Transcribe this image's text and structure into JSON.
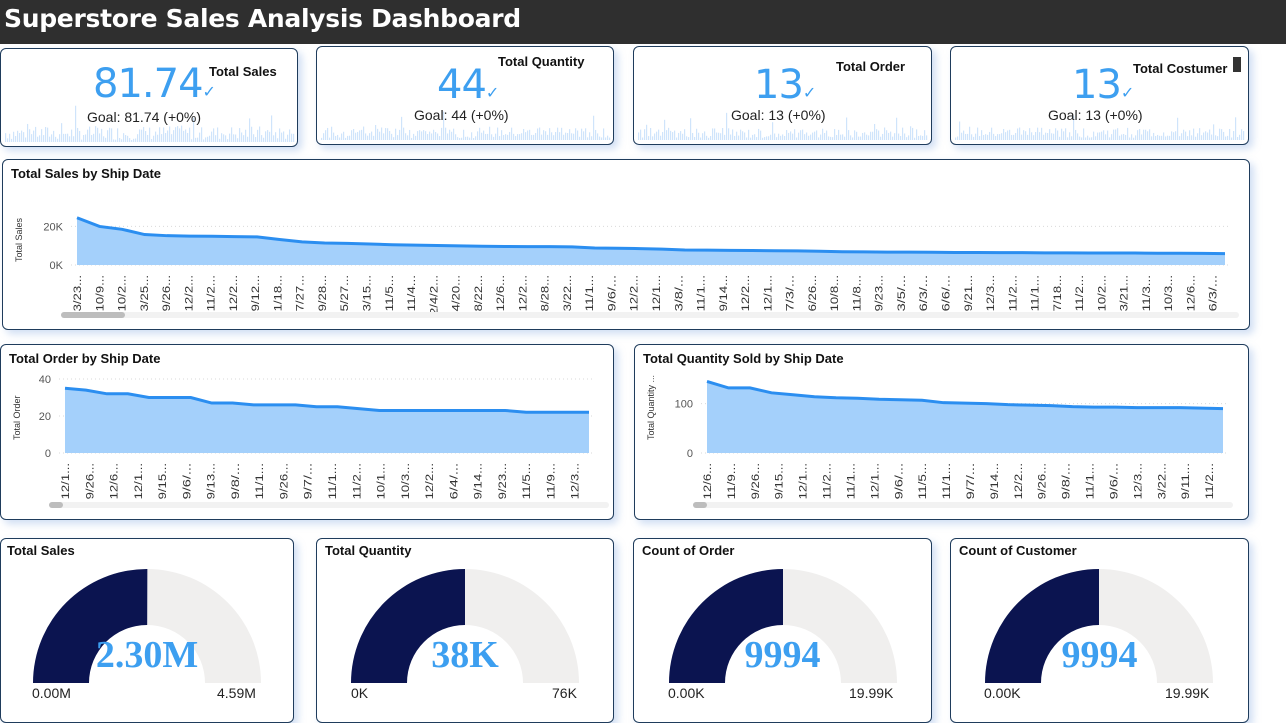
{
  "title": "Superstore Sales Analysis Dashboard",
  "kpis": [
    {
      "title": "Total Sales",
      "value": "81.74",
      "goal": "Goal: 81.74 (+0%)"
    },
    {
      "title": "Total Quantity",
      "value": "44",
      "goal": "Goal: 44 (+0%)"
    },
    {
      "title": "Total Order",
      "value": "13",
      "goal": "Goal: 13 (+0%)"
    },
    {
      "title": "Total Costumer",
      "value": "13",
      "goal": "Goal: 13 (+0%)"
    }
  ],
  "check_glyph": "✓",
  "charts": {
    "sales_by_ship_date": {
      "title": "Total Sales by Ship Date",
      "ylabel": "Total Sales",
      "yticks": [
        "20K",
        "0K"
      ]
    },
    "order_by_ship_date": {
      "title": "Total Order by Ship Date",
      "ylabel": "Total Order",
      "yticks": [
        "40",
        "20",
        "0"
      ]
    },
    "quantity_by_ship_date": {
      "title": "Total Quantity Sold by Ship Date",
      "ylabel": "Total Quantity ...",
      "yticks": [
        "100",
        "0"
      ]
    }
  },
  "chart_data": [
    {
      "type": "area",
      "title": "Total Sales by Ship Date",
      "ylabel": "Total Sales",
      "ylim": [
        0,
        28000
      ],
      "categories": [
        "3/23...",
        "10/9...",
        "10/2...",
        "3/25...",
        "9/26...",
        "12/2...",
        "11/2...",
        "12/2...",
        "9/12...",
        "1/18...",
        "7/27...",
        "9/28...",
        "5/27...",
        "3/15...",
        "11/5...",
        "11/4...",
        "2/4/2...",
        "4/20...",
        "8/22...",
        "12/6...",
        "12/2...",
        "8/28...",
        "3/22...",
        "11/1...",
        "9/6/...",
        "12/2...",
        "12/1...",
        "3/8/...",
        "11/1...",
        "9/14...",
        "12/2...",
        "12/1...",
        "7/3/...",
        "6/26...",
        "10/8...",
        "11/8...",
        "9/23...",
        "3/5/...",
        "6/3/...",
        "6/6/...",
        "9/21...",
        "12/3...",
        "11/2...",
        "11/1...",
        "7/18...",
        "11/2...",
        "10/2...",
        "3/21...",
        "11/3...",
        "10/3...",
        "12/6...",
        "6/3/..."
      ],
      "values": [
        24500,
        20000,
        18500,
        15800,
        15200,
        15000,
        14900,
        14700,
        14600,
        13200,
        12000,
        11400,
        11200,
        10900,
        10500,
        10300,
        10100,
        9900,
        9700,
        9600,
        9500,
        9500,
        9400,
        8800,
        8700,
        8500,
        8200,
        7800,
        7700,
        7600,
        7500,
        7400,
        7300,
        7100,
        6900,
        6800,
        6700,
        6700,
        6600,
        6500,
        6500,
        6400,
        6400,
        6300,
        6300,
        6200,
        6200,
        6200,
        6100,
        6100,
        6000,
        5900
      ]
    },
    {
      "type": "area",
      "title": "Total Order by Ship Date",
      "ylabel": "Total Order",
      "ylim": [
        0,
        40
      ],
      "categories": [
        "12/1...",
        "9/26...",
        "12/6...",
        "12/1...",
        "9/15...",
        "9/6/...",
        "9/13...",
        "9/8/...",
        "11/1...",
        "9/26...",
        "9/7/...",
        "11/1...",
        "11/2...",
        "10/1...",
        "10/3...",
        "12/2...",
        "6/4/...",
        "9/14...",
        "9/23...",
        "11/5...",
        "11/9...",
        "12/3..."
      ],
      "values": [
        35,
        34,
        32,
        32,
        30,
        30,
        30,
        27,
        27,
        26,
        26,
        26,
        25,
        25,
        24,
        23,
        23,
        23,
        23,
        23,
        23,
        23,
        22,
        22,
        22,
        22
      ]
    },
    {
      "type": "area",
      "title": "Total Quantity Sold by Ship Date",
      "ylabel": "Total Quantity ...",
      "ylim": [
        0,
        150
      ],
      "categories": [
        "12/6...",
        "11/9...",
        "9/26...",
        "9/15...",
        "12/1...",
        "11/2...",
        "11/1...",
        "12/1...",
        "9/6/...",
        "11/5...",
        "11/1...",
        "9/7/...",
        "9/14...",
        "12/2...",
        "9/26...",
        "9/8/...",
        "11/1...",
        "9/6/...",
        "12/3...",
        "3/22...",
        "9/11...",
        "11/2..."
      ],
      "values": [
        145,
        132,
        132,
        122,
        118,
        114,
        112,
        111,
        109,
        108,
        107,
        102,
        101,
        100,
        98,
        97,
        96,
        94,
        93,
        93,
        92,
        92,
        92,
        91,
        90
      ]
    }
  ],
  "gauges": [
    {
      "title": "Total Sales",
      "value": "2.30M",
      "min": "0.00M",
      "max": "4.59M",
      "fraction": 0.501
    },
    {
      "title": "Total Quantity",
      "value": "38K",
      "min": "0K",
      "max": "76K",
      "fraction": 0.5
    },
    {
      "title": "Count of Order",
      "value": "9994",
      "min": "0.00K",
      "max": "19.99K",
      "fraction": 0.5
    },
    {
      "title": "Count of Customer",
      "value": "9994",
      "min": "0.00K",
      "max": "19.99K",
      "fraction": 0.5
    }
  ],
  "colors": {
    "accent": "#3d9ff0",
    "area_fill": "#a4d0fb",
    "line": "#2b8ef0",
    "gauge_fill": "#0b1450",
    "gauge_bg": "#f0efee",
    "border": "#1f3c5c"
  }
}
